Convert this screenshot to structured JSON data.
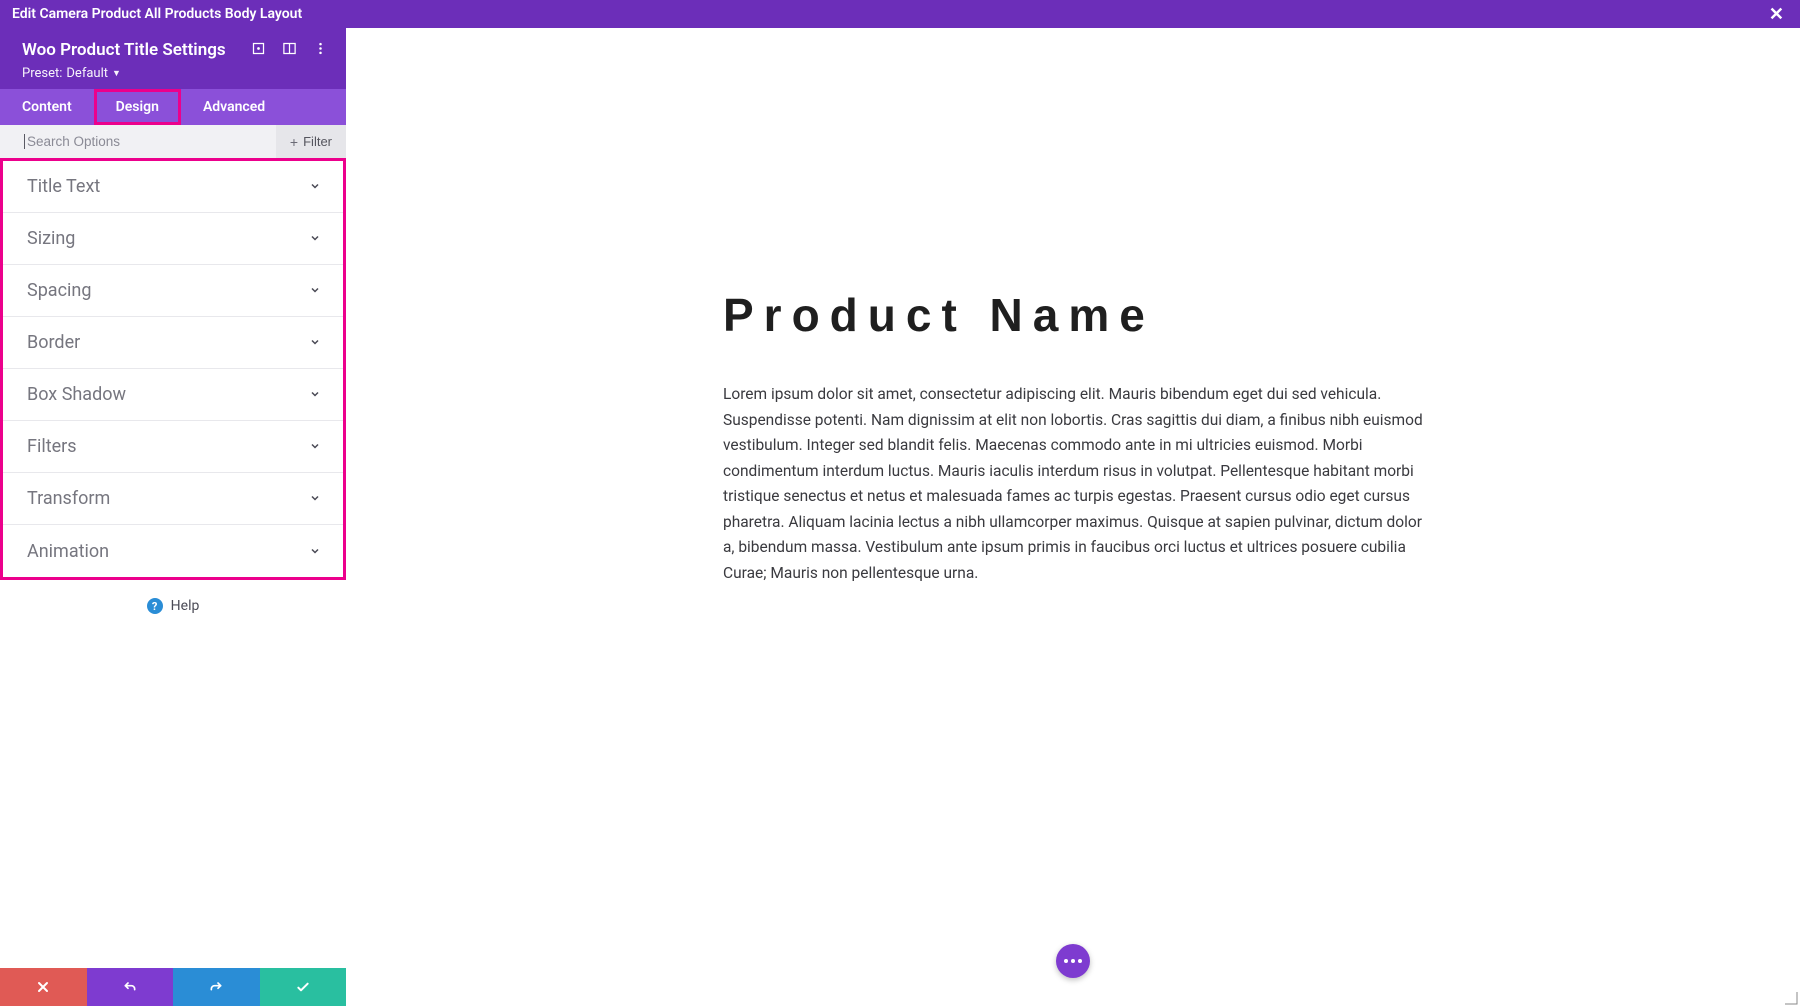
{
  "topbar": {
    "title": "Edit Camera Product All Products Body Layout"
  },
  "header": {
    "title": "Woo Product Title Settings",
    "preset_label": "Preset:",
    "preset_value": "Default"
  },
  "tabs": [
    {
      "label": "Content",
      "active": false
    },
    {
      "label": "Design",
      "active": true
    },
    {
      "label": "Advanced",
      "active": false
    }
  ],
  "search": {
    "placeholder": "Search Options",
    "filter_label": "Filter"
  },
  "accordion": [
    {
      "label": "Title Text"
    },
    {
      "label": "Sizing"
    },
    {
      "label": "Spacing"
    },
    {
      "label": "Border"
    },
    {
      "label": "Box Shadow"
    },
    {
      "label": "Filters"
    },
    {
      "label": "Transform"
    },
    {
      "label": "Animation"
    }
  ],
  "help_label": "Help",
  "preview": {
    "title": "Product Name",
    "body": "Lorem ipsum dolor sit amet, consectetur adipiscing elit. Mauris bibendum eget dui sed vehicula. Suspendisse potenti. Nam dignissim at elit non lobortis. Cras sagittis dui diam, a finibus nibh euismod vestibulum. Integer sed blandit felis. Maecenas commodo ante in mi ultricies euismod. Morbi condimentum interdum luctus. Mauris iaculis interdum risus in volutpat. Pellentesque habitant morbi tristique senectus et netus et malesuada fames ac turpis egestas. Praesent cursus odio eget cursus pharetra. Aliquam lacinia lectus a nibh ullamcorper maximus. Quisque at sapien pulvinar, dictum dolor a, bibendum massa. Vestibulum ante ipsum primis in faucibus orci luctus et ultrices posuere cubilia Curae; Mauris non pellentesque urna."
  }
}
